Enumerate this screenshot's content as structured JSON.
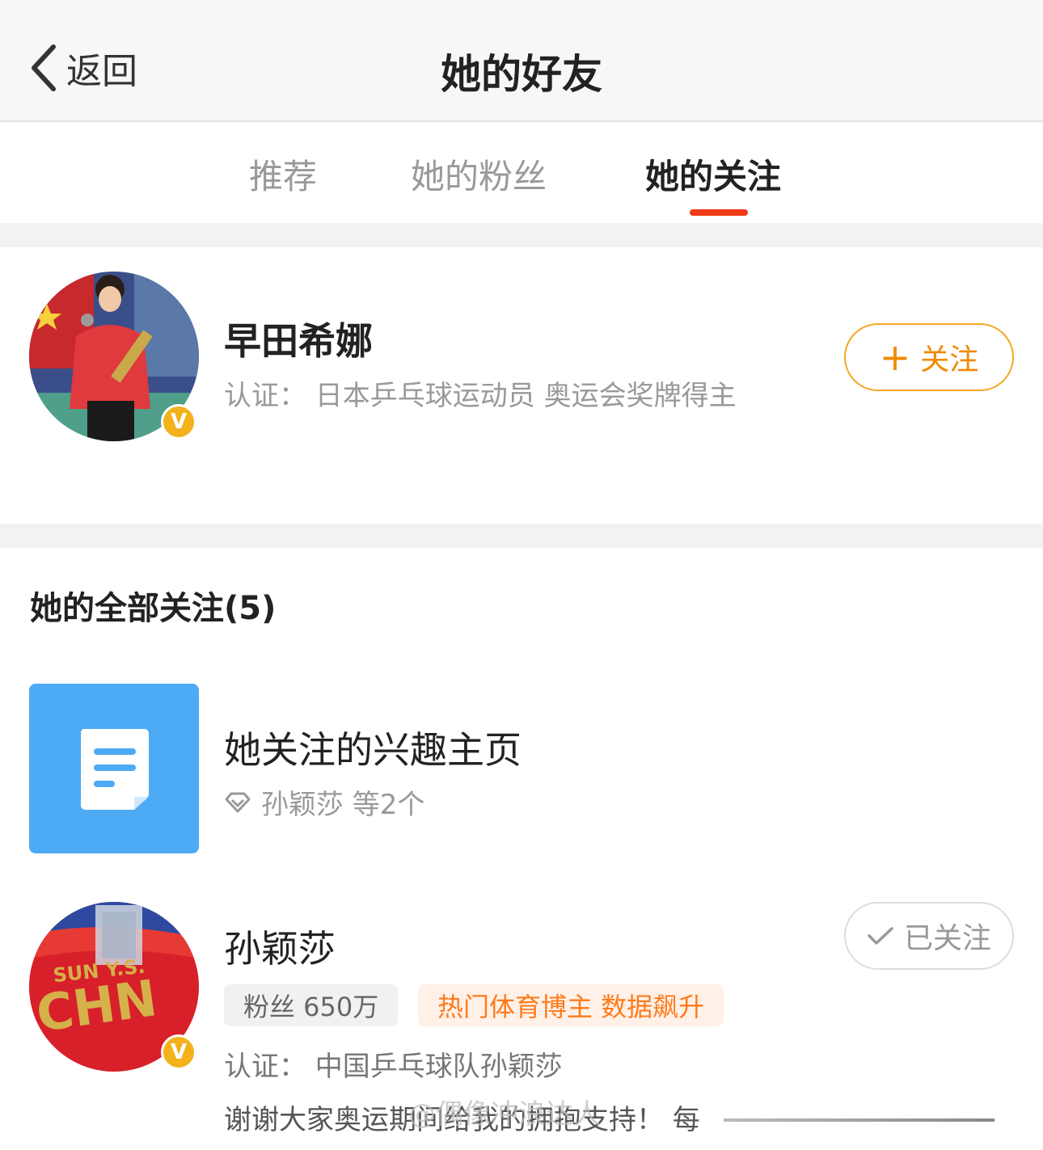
{
  "header": {
    "back_label": "返回",
    "title": "她的好友"
  },
  "tabs": [
    {
      "label": "推荐",
      "active": false
    },
    {
      "label": "她的粉丝",
      "active": false
    },
    {
      "label": "她的关注",
      "active": true
    }
  ],
  "colors": {
    "accent_red": "#f03a17",
    "follow_orange": "#f08a00",
    "interest_blue": "#4daaf5",
    "verified_gold": "#f3b21c"
  },
  "featured_user": {
    "name": "早田希娜",
    "verification": "认证： 日本乒乓球运动员 奥运会奖牌得主",
    "badge": "V",
    "follow_button": "关注",
    "follow_icon": "plus-icon"
  },
  "following_section": {
    "title": "她的全部关注(5)",
    "interest_page": {
      "title": "她关注的兴趣主页",
      "subtitle": "孙颖莎 等2个",
      "icon": "document-icon",
      "sub_icon": "diamond-icon"
    },
    "user": {
      "name": "孙颖莎",
      "badge": "V",
      "followed_button": "已关注",
      "followed_icon": "check-icon",
      "fans_tag": "粉丝 650万",
      "hot_tag": "热门体育博主 数据飙升",
      "verification": "认证： 中国乒乓球队孙颖莎",
      "bio": "谢谢大家奥运期间给我的拥抱支持！ 每"
    }
  },
  "watermark": "@偶像冲浪达人"
}
